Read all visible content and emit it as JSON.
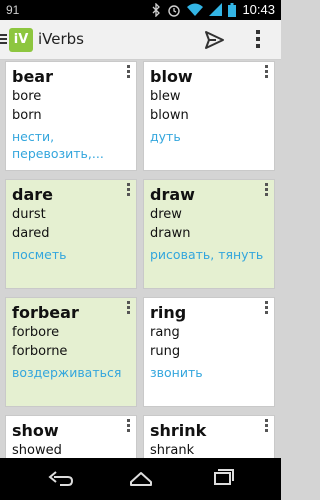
{
  "status_bar": {
    "notification": "91",
    "time": "10:43",
    "icons": [
      "bluetooth-icon",
      "alarm-icon",
      "wifi-icon",
      "signal-icon",
      "battery-icon"
    ]
  },
  "action_bar": {
    "logo": "iV",
    "title": "iVerbs",
    "icons": [
      "drawer-icon",
      "send-icon",
      "overflow-menu-icon"
    ]
  },
  "colors": {
    "learned_card": "#e5f0d1",
    "translation": "#33a6dd",
    "logo": "#8dc63f"
  },
  "verbs": [
    {
      "base": "bear",
      "past": "bore",
      "participle": "born",
      "translation": "нести, перевозить,...",
      "learned": false
    },
    {
      "base": "blow",
      "past": "blew",
      "participle": "blown",
      "translation": "дуть",
      "learned": false
    },
    {
      "base": "dare",
      "past": "durst",
      "participle": "dared",
      "translation": "посметь",
      "learned": true
    },
    {
      "base": "draw",
      "past": "drew",
      "participle": "drawn",
      "translation": "рисовать, тянуть",
      "learned": true
    },
    {
      "base": "forbear",
      "past": "forbore",
      "participle": "forborne",
      "translation": "воздерживаться",
      "learned": true
    },
    {
      "base": "ring",
      "past": "rang",
      "participle": "rung",
      "translation": "звонить",
      "learned": false
    },
    {
      "base": "show",
      "past": "showed",
      "participle": "",
      "translation": "",
      "learned": false
    },
    {
      "base": "shrink",
      "past": "shrank",
      "participle": "",
      "translation": "",
      "learned": false
    }
  ],
  "nav_bar": {
    "icons": [
      "back-icon",
      "home-icon",
      "recent-apps-icon"
    ]
  }
}
